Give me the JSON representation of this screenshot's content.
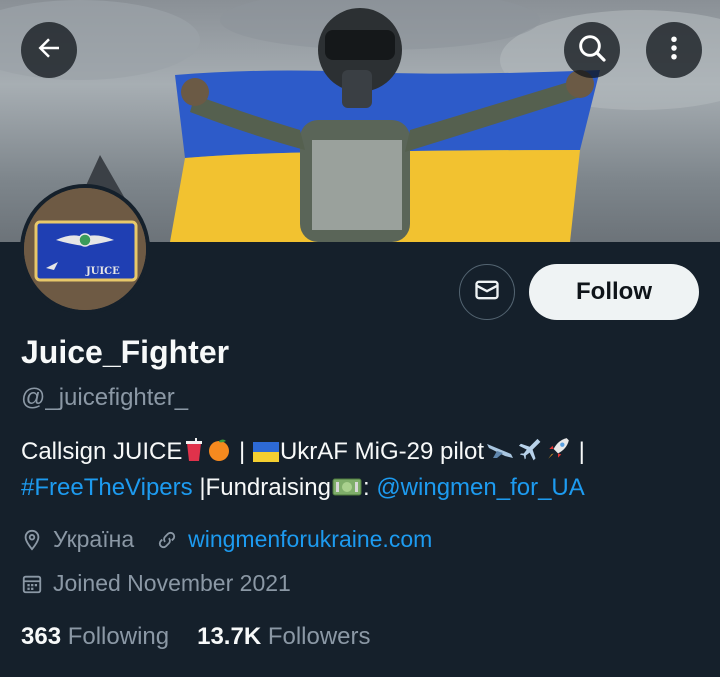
{
  "profile": {
    "display_name": "Juice_Fighter",
    "handle": "@_juicefighter_",
    "avatar_patch_text": "JUICE",
    "follow_label": "Follow",
    "bio": {
      "part1": "Callsign JUICE",
      "part2": " | ",
      "part3": "UkrAF MiG-29 pilot",
      "part4": " |",
      "hashtag": "#FreeTheVipers",
      "part5": " |Fundraising",
      "part6": ": ",
      "mention": "@wingmen_for_UA"
    },
    "location": "Україна",
    "website": "wingmenforukraine.com",
    "joined": "Joined November 2021",
    "following_count": "363",
    "following_label": "Following",
    "followers_count": "13.7K",
    "followers_label": "Followers"
  },
  "icons": {
    "back": "back-arrow-icon",
    "search": "search-icon",
    "more": "more-vertical-icon",
    "message": "envelope-icon",
    "location": "location-pin-icon",
    "link": "link-icon",
    "calendar": "calendar-icon"
  },
  "colors": {
    "background": "#15202b",
    "link": "#1d9bf0",
    "secondary_text": "#8b98a5",
    "flag_blue": "#2d5bc9",
    "flag_yellow": "#f2c230"
  }
}
